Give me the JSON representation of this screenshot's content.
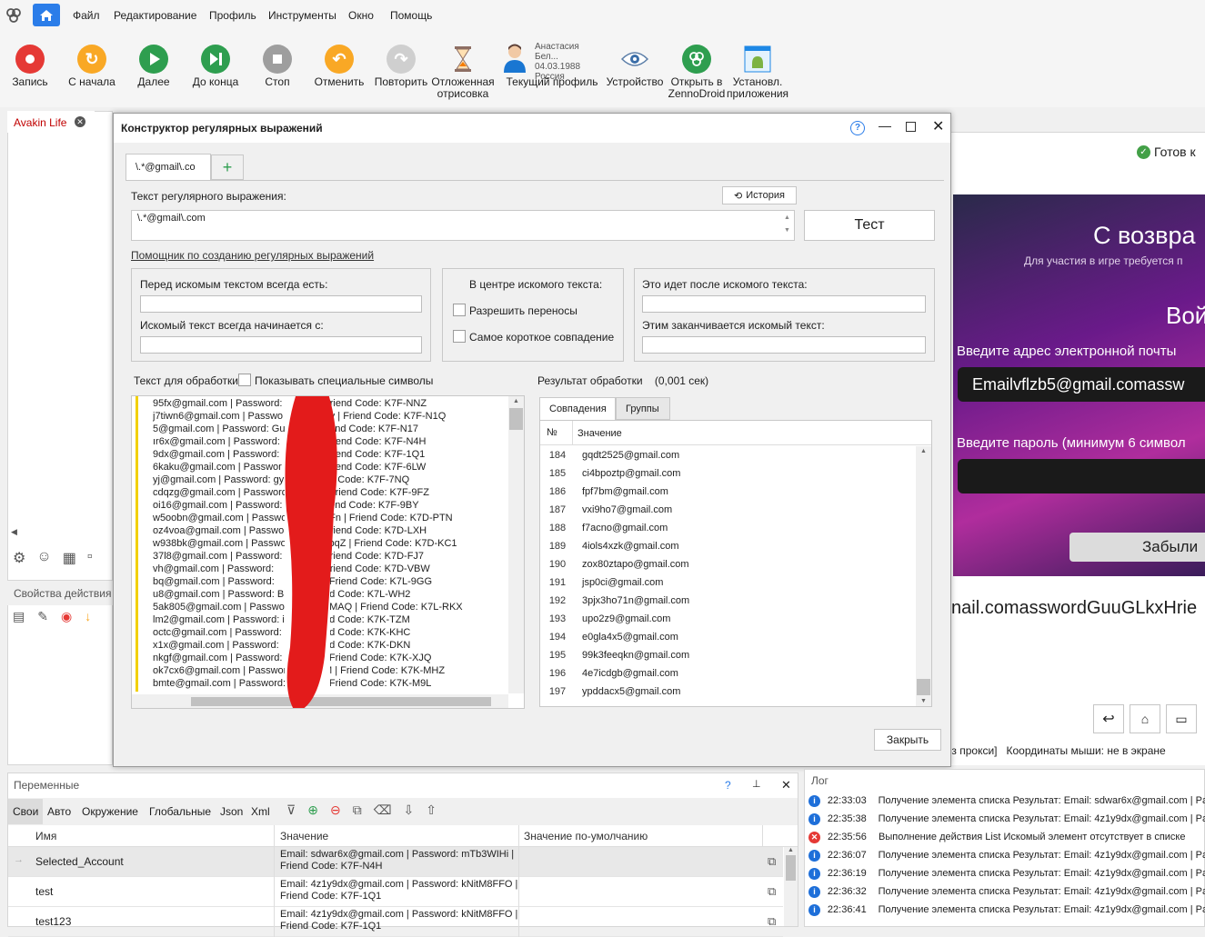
{
  "menu": {
    "items": [
      "Файл",
      "Редактирование",
      "Профиль",
      "Инструменты",
      "Окно",
      "Помощь"
    ]
  },
  "toolbar": {
    "buttons": [
      {
        "label": "Запись",
        "icon": "record-icon",
        "color": "#e53935"
      },
      {
        "label": "С начала",
        "icon": "restart-icon",
        "color": "#f9a825"
      },
      {
        "label": "Далее",
        "icon": "play-icon",
        "color": "#2e9e4f"
      },
      {
        "label": "До конца",
        "icon": "skip-end-icon",
        "color": "#2e9e4f"
      },
      {
        "label": "Стоп",
        "icon": "stop-icon",
        "color": "#9e9e9e"
      },
      {
        "label": "Отменить",
        "icon": "undo-icon",
        "color": "#f9a825"
      },
      {
        "label": "Повторить",
        "icon": "redo-icon",
        "color": "#cfcfcf"
      }
    ],
    "delayed_render": [
      "Отложенная",
      "отрисовка"
    ],
    "profile": {
      "name": "Анастасия Бел...",
      "date": "04.03.1988",
      "country": "Россия",
      "label": "Текущий профиль"
    },
    "device_label": "Устройство",
    "zennodroid": [
      "Открыть в",
      "ZennoDroid"
    ],
    "install_apps": [
      "Установл.",
      "приложения"
    ]
  },
  "left": {
    "tab": "Avakin Life",
    "props_title": "Свойства действия"
  },
  "dialog": {
    "title": "Конструктор регулярных выражений",
    "tab": "\\.*@gmail\\.co",
    "regex_label": "Текст регулярного выражения:",
    "history": "История",
    "regex_value": "\\.*@gmail\\.com",
    "test": "Тест",
    "helper_link": "Помощник по созданию регулярных выражений",
    "before_label": "Перед искомым текстом всегда есть:",
    "starts_label": "Искомый текст всегда начинается с:",
    "center_label": "В центре искомого текста:",
    "allow_wrap": "Разрешить переносы",
    "shortest": "Самое короткое совпадение",
    "after_label": "Это идет после искомого текста:",
    "ends_label": "Этим заканчивается искомый текст:",
    "text_label": "Текст для обработки",
    "show_special": "Показывать специальные символы",
    "result_label": "Результат обработки",
    "result_time": "(0,001 сек)",
    "tab_matches": "Совпадения",
    "tab_groups": "Группы",
    "col_num": "№",
    "col_value": "Значение",
    "close": "Закрыть",
    "source_lines": [
      {
        "l": "95fx@gmail.com | Password:",
        "r": "Friend Code: K7F-NNZ"
      },
      {
        "l": "j7tiwn6@gmail.com | Passwo",
        "r": "Yv | Friend Code: K7F-N1Q"
      },
      {
        "l": "5@gmail.com | Password: Gu",
        "r": "riend Code: K7F-N17"
      },
      {
        "l": "ır6x@gmail.com | Password:",
        "r": "Friend Code: K7F-N4H"
      },
      {
        "l": "9dx@gmail.com | Password:",
        "r": "Friend Code: K7F-1Q1"
      },
      {
        "l": "6kaku@gmail.com | Passwor",
        "r": "Friend Code: K7F-6LW"
      },
      {
        "l": "yj@gmail.com | Password: gy",
        "r": "nd Code: K7F-7NQ"
      },
      {
        "l": "cdqzg@gmail.com | Password",
        "r": "| Friend Code: K7F-9FZ"
      },
      {
        "l": "oi16@gmail.com | Password:",
        "r": "riend Code: K7F-9BY"
      },
      {
        "l": "w5oobn@gmail.com | Passwo",
        "r": "uFn | Friend Code: K7D-PTN"
      },
      {
        "l": "oz4voa@gmail.com | Passwor",
        "r": "Friend Code: K7D-LXH"
      },
      {
        "l": "w938bk@gmail.com | Passwo",
        "r": "kbqZ | Friend Code: K7D-KC1"
      },
      {
        "l": "37l8@gmail.com | Password:",
        "r": "Friend Code: K7D-FJ7"
      },
      {
        "l": "vh@gmail.com | Password:",
        "r": "Friend Code: K7D-VBW"
      },
      {
        "l": "bq@gmail.com | Password:",
        "r": "| Friend Code: K7L-9GG"
      },
      {
        "l": "u8@gmail.com | Password: Bi",
        "r": "nd Code: K7L-WH2"
      },
      {
        "l": "5ak805@gmail.com | Passwo",
        "r": "qMAQ | Friend Code: K7L-RKX"
      },
      {
        "l": "lm2@gmail.com | Password: i",
        "r": "nd Code: K7K-TZM"
      },
      {
        "l": "octc@gmail.com | Password:",
        "r": "nd Code: K7K-KHC"
      },
      {
        "l": "x1x@gmail.com | Password:",
        "r": "nd Code: K7K-DKN"
      },
      {
        "l": "nkgf@gmail.com | Password:",
        "r": "| Friend Code: K7K-XJQ"
      },
      {
        "l": "ok7cx6@gmail.com | Passwor",
        "r": "M | Friend Code: K7K-MHZ"
      },
      {
        "l": "bmte@gmail.com | Password:",
        "r": "| Friend Code: K7K-M9L"
      }
    ],
    "results": [
      {
        "n": "184",
        "v": "gqdt2525@gmail.com"
      },
      {
        "n": "185",
        "v": "ci4bpoztp@gmail.com"
      },
      {
        "n": "186",
        "v": "fpf7bm@gmail.com"
      },
      {
        "n": "187",
        "v": "vxi9ho7@gmail.com"
      },
      {
        "n": "188",
        "v": "f7acno@gmail.com"
      },
      {
        "n": "189",
        "v": "4iols4xzk@gmail.com"
      },
      {
        "n": "190",
        "v": "zox80ztapo@gmail.com"
      },
      {
        "n": "191",
        "v": "jsp0ci@gmail.com"
      },
      {
        "n": "192",
        "v": "3pjx3ho71n@gmail.com"
      },
      {
        "n": "193",
        "v": "upo2z9@gmail.com"
      },
      {
        "n": "194",
        "v": "e0gla4x5@gmail.com"
      },
      {
        "n": "195",
        "v": "99k3feeqkn@gmail.com"
      },
      {
        "n": "196",
        "v": "4e7icdgb@gmail.com"
      },
      {
        "n": "197",
        "v": "ypddacx5@gmail.com"
      }
    ]
  },
  "right": {
    "ready": "Готов к",
    "welcome": "С возвра",
    "sub": "Для участия в игре требуется п",
    "login": "Вой",
    "email_label": "Введите адрес электронной почты",
    "email_value": "Emailvflzb5@gmail.comassw",
    "pass_label": "Введите пароль (минимум 6 символ",
    "forgot": "Забыли",
    "below_text": "nail.comasswordGuuGLkxHrie",
    "status": "ез прокси]   Координаты мыши: не в экране"
  },
  "vars": {
    "title": "Переменные",
    "tabs": [
      "Свои",
      "Авто",
      "Окружение",
      "Глобальные",
      "Json",
      "Xml"
    ],
    "cols": [
      "Имя",
      "Значение",
      "Значение по-умолчанию"
    ],
    "rows": [
      {
        "name": "Selected_Account",
        "v1": "Email: sdwar6x@gmail.com | Password: mTb3WIHi |",
        "v2": "Friend Code: K7F-N4H"
      },
      {
        "name": "test",
        "v1": "Email: 4z1y9dx@gmail.com | Password: kNitM8FFO |",
        "v2": "Friend Code: K7F-1Q1"
      },
      {
        "name": "test123",
        "v1": "Email: 4z1y9dx@gmail.com | Password: kNitM8FFO |",
        "v2": "Friend Code: K7F-1Q1"
      }
    ]
  },
  "log": {
    "title": "Лог",
    "rows": [
      {
        "t": "22:33:03",
        "m": "Получение элемента списка  Результат: Email: sdwar6x@gmail.com | Pa",
        "type": "info"
      },
      {
        "t": "22:35:38",
        "m": "Получение элемента списка  Результат: Email: 4z1y9dx@gmail.com | Pa",
        "type": "info"
      },
      {
        "t": "22:35:56",
        "m": "Выполнение действия List Искомый элемент отсутствует в списке",
        "type": "error"
      },
      {
        "t": "22:36:07",
        "m": "Получение элемента списка  Результат: Email: 4z1y9dx@gmail.com | Pa",
        "type": "info"
      },
      {
        "t": "22:36:19",
        "m": "Получение элемента списка  Результат: Email: 4z1y9dx@gmail.com | Pa",
        "type": "info"
      },
      {
        "t": "22:36:32",
        "m": "Получение элемента списка  Результат: Email: 4z1y9dx@gmail.com | Pa",
        "type": "info"
      },
      {
        "t": "22:36:41",
        "m": "Получение элемента списка  Результат: Email: 4z1y9dx@gmail.com | Pa",
        "type": "info"
      }
    ]
  }
}
